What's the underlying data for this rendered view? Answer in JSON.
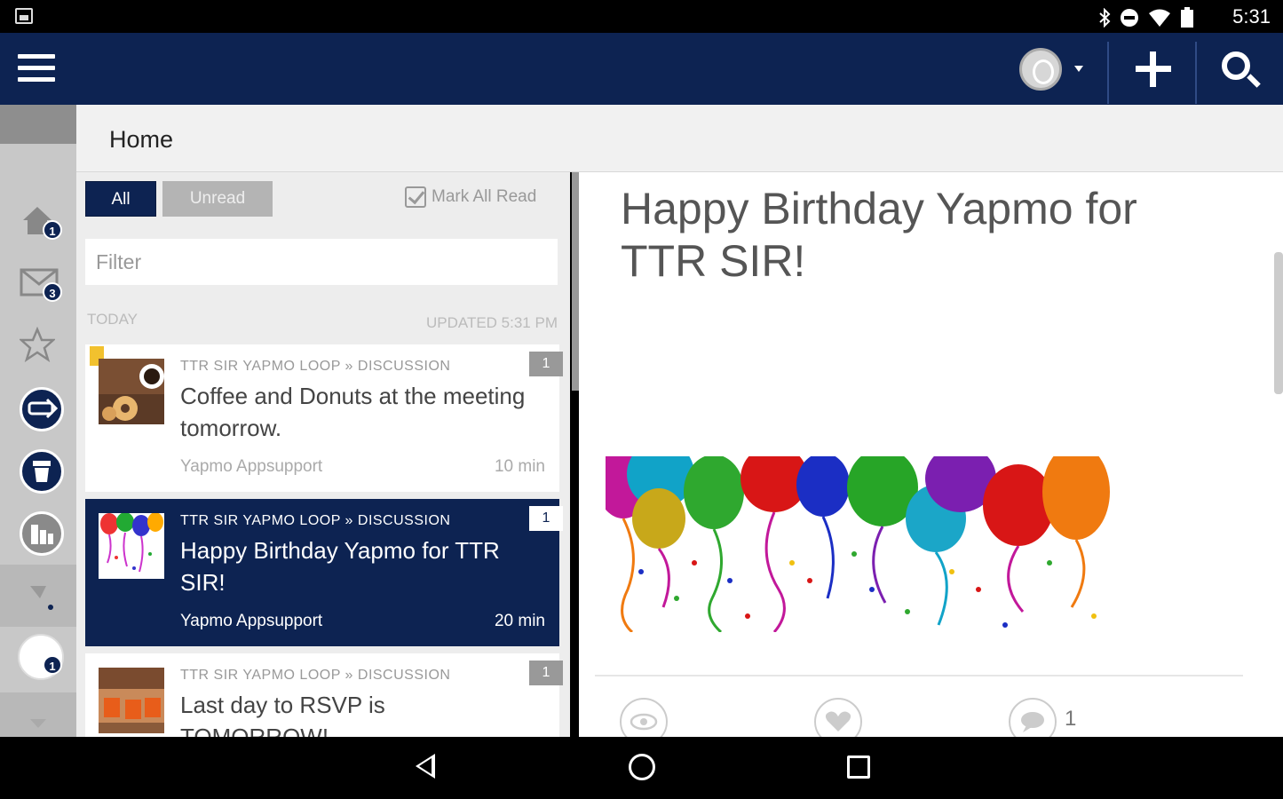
{
  "status_bar": {
    "time": "5:31",
    "icons": [
      "photo-icon",
      "bluetooth-icon",
      "do-not-disturb-icon",
      "wifi-icon",
      "battery-icon"
    ]
  },
  "app_bar": {
    "icons": [
      "menu-icon",
      "avatar-icon",
      "add-icon",
      "search-icon"
    ]
  },
  "left_rail": {
    "items": [
      {
        "name": "home-icon",
        "badge": "1"
      },
      {
        "name": "mail-icon",
        "badge": "3"
      },
      {
        "name": "star-icon",
        "badge": ""
      },
      {
        "name": "loop-icon",
        "badge": ""
      },
      {
        "name": "coffee-icon",
        "badge": ""
      },
      {
        "name": "building-icon",
        "badge": ""
      }
    ],
    "bottom_badge": "1"
  },
  "header": {
    "title": "Home"
  },
  "list": {
    "filter_all": "All",
    "filter_unread": "Unread",
    "mark_all_read": "Mark All Read",
    "filter_placeholder": "Filter",
    "section_label": "TODAY",
    "updated_label": "UPDATED 5:31 PM",
    "items": [
      {
        "category": "TTR SIR YAPMO LOOP » DISCUSSION",
        "title": "Coffee and Donuts at the meeting tomorrow.",
        "author": "Yapmo Appsupport",
        "time": "10 min",
        "count": "1"
      },
      {
        "category": "TTR SIR YAPMO LOOP » DISCUSSION",
        "title": "Happy Birthday Yapmo for TTR SIR!",
        "author": "Yapmo Appsupport",
        "time": "20 min",
        "count": "1"
      },
      {
        "category": "TTR SIR YAPMO LOOP » DISCUSSION",
        "title": "Last day to RSVP is TOMORROW!",
        "author": "",
        "time": "",
        "count": "1"
      }
    ]
  },
  "content": {
    "title": "Happy Birthday Yapmo for TTR SIR!",
    "comment_count": "1",
    "colors": {
      "navy": "#0d2352",
      "selected": "#0d2352",
      "accent_yellow": "#f2c12e"
    }
  },
  "nav_bar": {
    "icons": [
      "back-icon",
      "home-circle-icon",
      "recents-icon"
    ]
  }
}
